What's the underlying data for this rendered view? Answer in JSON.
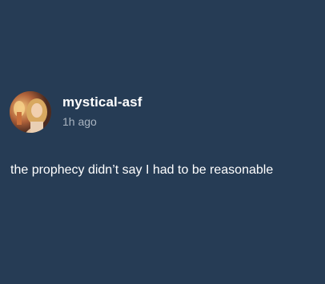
{
  "post": {
    "author": {
      "username": "mystical-asf",
      "avatar_icon": "user-avatar-photo"
    },
    "timestamp": "1h ago",
    "text": "the prophecy didn’t say I had to be reasonable"
  },
  "colors": {
    "background": "#263c55",
    "username": "#ffffff",
    "timestamp": "#a9b4c0",
    "text": "#ffffff"
  }
}
